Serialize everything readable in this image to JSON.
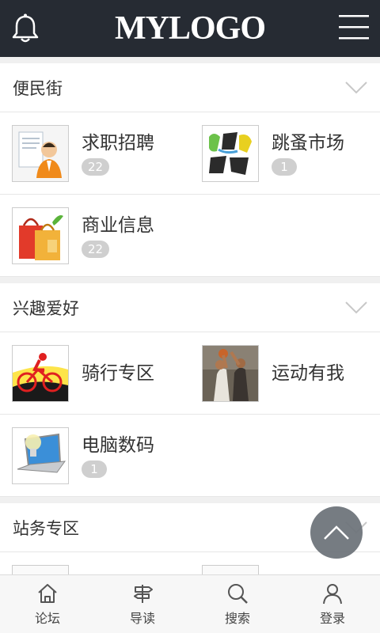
{
  "header": {
    "logo_text": "MYLOGO"
  },
  "sections": [
    {
      "title": "便民街",
      "items": [
        {
          "name": "求职招聘",
          "badge": "22",
          "icon": "job-icon"
        },
        {
          "name": "跳蚤市场",
          "badge": "1",
          "icon": "flea-market-icon"
        },
        {
          "name": "商业信息",
          "badge": "22",
          "icon": "shopping-bag-icon"
        }
      ]
    },
    {
      "title": "兴趣爱好",
      "items": [
        {
          "name": "骑行专区",
          "icon": "cycling-icon"
        },
        {
          "name": "运动有我",
          "icon": "sports-icon"
        },
        {
          "name": "电脑数码",
          "badge": "1",
          "icon": "computer-icon"
        }
      ]
    },
    {
      "title": "站务专区"
    }
  ],
  "tabs": [
    {
      "label": "论坛",
      "icon": "home-icon"
    },
    {
      "label": "导读",
      "icon": "signpost-icon"
    },
    {
      "label": "搜索",
      "icon": "search-icon"
    },
    {
      "label": "登录",
      "icon": "user-icon"
    }
  ],
  "colors": {
    "topbar": "#262b33",
    "badge": "#cfcfcf",
    "fab": "#6f757c"
  }
}
